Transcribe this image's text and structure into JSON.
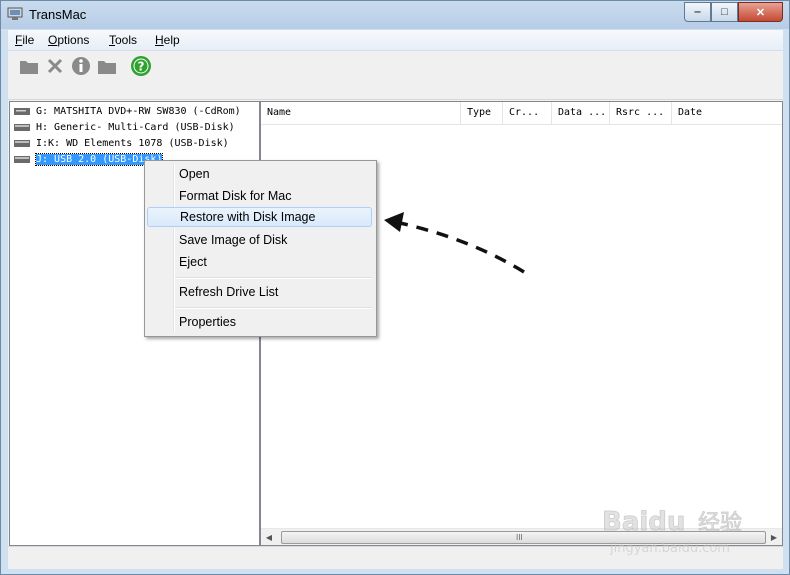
{
  "window": {
    "title": "TransMac"
  },
  "caption": {
    "minimize": "‒",
    "maximize": "□",
    "close": "✕"
  },
  "menu": [
    {
      "label": "File",
      "key": "F",
      "rest": "ile"
    },
    {
      "label": "Options",
      "key": "O",
      "rest": "ptions"
    },
    {
      "label": "Tools",
      "key": "T",
      "rest": "ools"
    },
    {
      "label": "Help",
      "key": "H",
      "rest": "elp"
    }
  ],
  "toolbar": {
    "icons": [
      "folder-icon",
      "delete-x-icon",
      "info-icon",
      "folder-icon",
      "help-icon"
    ],
    "help_glyph": "?"
  },
  "drives": [
    {
      "label": "G: MATSHITA DVD+-RW SW830 (-CdRom)",
      "icon": "cdrom-icon"
    },
    {
      "label": "H: Generic- Multi-Card (USB-Disk)",
      "icon": "drive-icon"
    },
    {
      "label": "I:K: WD Elements 1078 (USB-Disk)",
      "icon": "drive-icon"
    },
    {
      "label": "J: USB 2.0 (USB-Disk)",
      "icon": "drive-icon",
      "selected": true
    }
  ],
  "columns": [
    "Name",
    "Type",
    "Cr...",
    "Data ...",
    "Rsrc ...",
    "Date"
  ],
  "context_menu": {
    "items": [
      {
        "label": "Open"
      },
      {
        "label": "Format Disk for Mac"
      },
      {
        "label": "Restore with Disk Image",
        "highlighted": true
      },
      {
        "label": "Save Image of Disk"
      },
      {
        "label": "Eject"
      },
      {
        "label": "Refresh Drive List"
      },
      {
        "label": "Properties"
      }
    ]
  },
  "scrollbar": {
    "left": "◀",
    "right": "▶",
    "grip": "III"
  },
  "watermark": {
    "brand": "Baidu",
    "cn": "经验",
    "url": "jingyan.baidu.com"
  },
  "colors": {
    "selection": "#3399ff",
    "help": "#2ea12e",
    "menu_highlight": "#d9e9fb"
  }
}
